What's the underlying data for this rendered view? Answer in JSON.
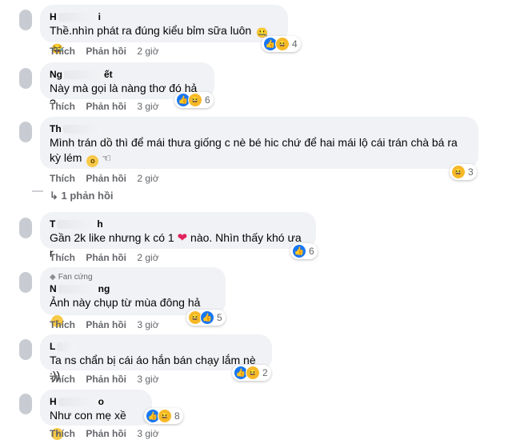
{
  "comments": [
    {
      "author_visible": "H",
      "author_visible_end": "i",
      "text": "Thề.nhìn phát ra đúng kiểu bỉm sữa luôn",
      "emoji": "🤐",
      "emoji2": "😂",
      "reaction_count": "4",
      "like_label": "Thích",
      "reply_label": "Phản hồi",
      "time": "2 giờ"
    },
    {
      "author_visible": "Ng",
      "author_visible_end": "ết",
      "text": "Này mà gọi là nàng thơ đó hả ?",
      "reaction_count": "6",
      "like_label": "Thích",
      "reply_label": "Phản hồi",
      "time": "3 giờ"
    },
    {
      "author_visible": "Th",
      "author_visible_end": "",
      "text_line1": "Mình trán dồ thì để mái thưa giống c nè bé hic chứ để hai mái lộ cái trán chà bá ra",
      "text_line2": "kỳ lém",
      "reaction_count": "3",
      "like_label": "Thích",
      "reply_label": "Phản hồi",
      "time": "2 giờ",
      "replies_label": "↳ 1 phản hồi"
    },
    {
      "author_visible": "T",
      "author_visible_end": "h",
      "text_before": "Gần 2k like nhưng k có 1",
      "text_after": "nào. Nhìn thấy khó ưa r",
      "reaction_count": "6",
      "like_label": "Thích",
      "reply_label": "Phản hồi",
      "time": "2 giờ"
    },
    {
      "badge": "Fan cứng",
      "author_visible": "N",
      "author_visible_end": "ng",
      "text": "Ảnh này chụp từ mùa đông hả",
      "reaction_count": "5",
      "like_label": "Thích",
      "reply_label": "Phản hồi",
      "time": "3 giờ"
    },
    {
      "author_visible": "L",
      "author_visible_end": "",
      "text": "Ta ns chẩn bị cái áo hắn bán chạy lắm nè :))",
      "reaction_count": "2",
      "like_label": "Thích",
      "reply_label": "Phản hồi",
      "time": "3 giờ"
    },
    {
      "author_visible": "H",
      "author_visible_end": "o",
      "text": "Như con mẹ xề",
      "reaction_count": "8",
      "like_label": "Thích",
      "reply_label": "Phản hồi",
      "time": "3 giờ"
    }
  ],
  "colors": {
    "like_blue": "#1877f2",
    "haha_yellow": "#f7b928",
    "bubble_bg": "#f0f2f5",
    "meta_gray": "#65676b"
  },
  "icons": [
    "like-icon",
    "haha-icon",
    "heart-icon",
    "diamond-icon",
    "grin-emoji-icon",
    "astonished-emoji-icon"
  ]
}
